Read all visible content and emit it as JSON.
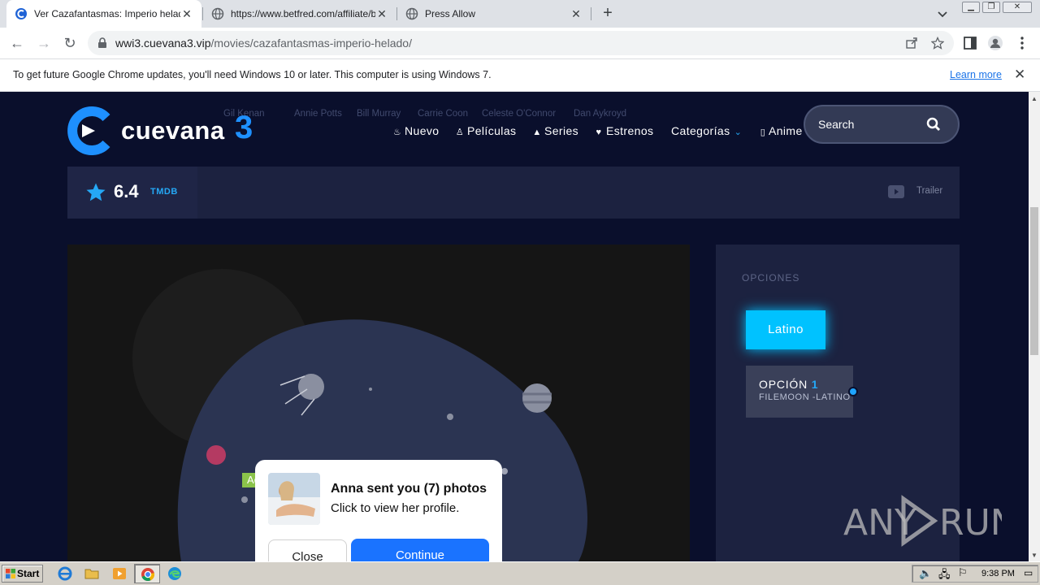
{
  "browser": {
    "tabs": [
      {
        "title": "Ver Cazafantasmas: Imperio helado",
        "active": true
      },
      {
        "title": "https://www.betfred.com/affiliate/b",
        "active": false
      },
      {
        "title": "Press Allow",
        "active": false
      }
    ],
    "url_host": "wwi3.cuevana3.vip",
    "url_path": "/movies/cazafantasmas-imperio-helado/",
    "infobar": {
      "message": "To get future Google Chrome updates, you'll need Windows 10 or later. This computer is using Windows 7.",
      "link": "Learn more"
    }
  },
  "site": {
    "logo_text": "cuevana",
    "logo_number": "3",
    "cast": [
      "Gil Kenan",
      "Annie Potts",
      "Bill Murray",
      "Carrie Coon",
      "Celeste O'Connor",
      "Dan Aykroyd"
    ],
    "nav": [
      {
        "label": "Nuevo",
        "icon": "fire-icon"
      },
      {
        "label": "Películas",
        "icon": "person-icon"
      },
      {
        "label": "Series",
        "icon": "triangle-icon"
      },
      {
        "label": "Estrenos",
        "icon": "heart-icon"
      },
      {
        "label": "Categorías",
        "icon": "chevron-down-icon"
      },
      {
        "label": "Anime",
        "icon": "box-icon"
      }
    ],
    "search_placeholder": "Search",
    "rating": {
      "score": "6.4",
      "source": "TMDB"
    },
    "trailer_label": "Trailer",
    "options": {
      "heading": "OPCIONES",
      "language": "Latino",
      "option_label": "OPCIÓN",
      "option_number": "1",
      "option_server": "FILEMOON -LATINO"
    },
    "accent_color": "#00c2ff"
  },
  "ad": {
    "tag": "Ad",
    "headline": "Anna sent you (7) photos",
    "subline": "Click to view her profile.",
    "close_label": "Close",
    "continue_label": "Continue"
  },
  "taskbar": {
    "start_label": "Start",
    "clock": "9:38 PM"
  }
}
